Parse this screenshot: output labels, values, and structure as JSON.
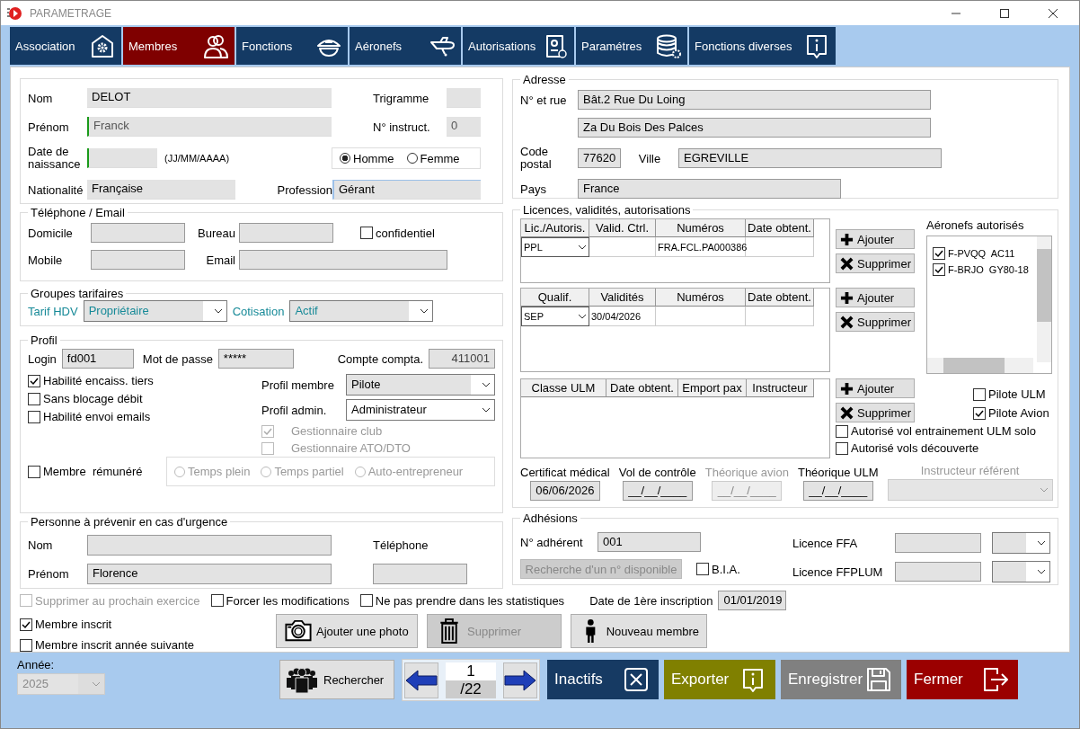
{
  "window": {
    "title": "PARAMETRAGE"
  },
  "tabs": [
    {
      "label": "Association",
      "selected": false
    },
    {
      "label": "Membres",
      "selected": true
    },
    {
      "label": "Fonctions",
      "selected": false
    },
    {
      "label": "Aéronefs",
      "selected": false
    },
    {
      "label": "Autorisations",
      "selected": false
    },
    {
      "label": "Paramétres",
      "selected": false
    },
    {
      "label": "Fonctions diverses",
      "selected": false
    }
  ],
  "identity": {
    "nom": {
      "label": "Nom",
      "value": "DELOT"
    },
    "prenom": {
      "label": "Prénom",
      "value": "Franck"
    },
    "naissance": {
      "label": "Date de naissance",
      "hint": "(JJ/MM/AAAA)"
    },
    "trigramme": {
      "label": "Trigramme"
    },
    "instruct": {
      "label": "N° instruct.",
      "value": "0"
    },
    "genre": [
      {
        "label": "Homme",
        "selected": true
      },
      {
        "label": "Femme",
        "selected": false
      }
    ],
    "nationalite": {
      "label": "Nationalité",
      "value": "Française"
    },
    "profession": {
      "label": "Profession",
      "value": "Gérant"
    }
  },
  "contact": {
    "title": "Téléphone / Email",
    "domicile": {
      "label": "Domicile"
    },
    "bureau": {
      "label": "Bureau"
    },
    "confidentiel": {
      "label": "confidentiel",
      "checked": false
    },
    "mobile": {
      "label": "Mobile"
    },
    "email": {
      "label": "Email"
    }
  },
  "tarifs": {
    "title": "Groupes tarifaires",
    "tarif_hdv": {
      "label": "Tarif HDV",
      "value": "Propriétaire"
    },
    "cotisation": {
      "label": "Cotisation",
      "value": "Actif"
    }
  },
  "profil": {
    "title": "Profil",
    "login": {
      "label": "Login",
      "value": "fd001"
    },
    "mot_de_passe": {
      "label": "Mot de passe",
      "value": "*****"
    },
    "compte": {
      "label": "Compte compta.",
      "value": "411001"
    },
    "options": [
      {
        "label": "Habilité encaiss. tiers",
        "checked": true
      },
      {
        "label": "Sans blocage débit",
        "checked": false
      },
      {
        "label": "Habilité envoi emails",
        "checked": false
      }
    ],
    "profil_membre": {
      "label": "Profil membre",
      "value": "Pilote"
    },
    "profil_admin": {
      "label": "Profil admin.",
      "value": "Administrateur"
    },
    "roles": [
      {
        "label": "Gestionnaire club",
        "checked": true,
        "disabled": true
      },
      {
        "label": "Gestionnaire ATO/DTO",
        "checked": false,
        "disabled": true
      }
    ],
    "remunere": {
      "label": "Membre  rémunéré",
      "checked": false
    },
    "contrat": [
      {
        "label": "Temps plein",
        "selected": false,
        "disabled": true
      },
      {
        "label": "Temps partiel",
        "selected": false,
        "disabled": true
      },
      {
        "label": "Auto-entrepreneur",
        "selected": false,
        "disabled": true
      }
    ]
  },
  "urgence": {
    "title": "Personne à prévenir en cas d'urgence",
    "nom": {
      "label": "Nom"
    },
    "prenom": {
      "label": "Prénom",
      "value": "Florence"
    },
    "telephone": {
      "label": "Téléphone"
    }
  },
  "adresse": {
    "title": "Adresse",
    "rue": {
      "label": "N° et rue",
      "lines": [
        "Bât.2 Rue Du Loing",
        "Za Du Bois Des Palces"
      ]
    },
    "code_postal": {
      "label": "Code postal",
      "value": "77620"
    },
    "ville": {
      "label": "Ville",
      "value": "EGREVILLE"
    },
    "pays": {
      "label": "Pays",
      "value": "France"
    }
  },
  "licences": {
    "title": "Licences, validités, autorisations",
    "tables": [
      {
        "columns": [
          "Lic./Autoris.",
          "Valid. Ctrl.",
          "Numéros",
          "Date obtent."
        ],
        "rows": [
          {
            "choice": "PPL",
            "cells": {
              "2": "FRA.FCL.PA000386"
            }
          }
        ],
        "actions": [
          "Ajouter",
          "Supprimer"
        ]
      },
      {
        "columns": [
          "Qualif.",
          "Validités",
          "Numéros",
          "Date obtent."
        ],
        "rows": [
          {
            "choice": "SEP",
            "cells": {
              "1": "30/04/2026"
            }
          }
        ],
        "actions": [
          "Ajouter",
          "Supprimer"
        ]
      },
      {
        "columns": [
          "Classe ULM",
          "Date obtent.",
          "Emport pax",
          "Instructeur"
        ],
        "actions": [
          "Ajouter",
          "Supprimer"
        ]
      }
    ],
    "aeronefs": {
      "title": "Aéronefs autorisés",
      "items": [
        {
          "label": "F-PVQQ  AC11",
          "checked": true
        },
        {
          "label": "F-BRJO  GY80-18",
          "checked": true
        }
      ]
    },
    "pilote": [
      {
        "label": "Pilote ULM",
        "checked": false
      },
      {
        "label": "Pilote Avion",
        "checked": true
      }
    ],
    "autorisations": [
      {
        "label": "Autorisé vol entrainement ULM solo",
        "checked": false
      },
      {
        "label": "Autorisé vols découverte",
        "checked": false
      }
    ],
    "dates": [
      {
        "label": "Certificat médical",
        "value": "06/06/2026",
        "disabled": false
      },
      {
        "label": "Vol de contrôle",
        "value": "__/__/____",
        "disabled": false
      },
      {
        "label": "Théorique avion",
        "value": "__/__/____",
        "disabled": true
      },
      {
        "label": "Théorique ULM",
        "value": "__/__/____",
        "disabled": false
      }
    ],
    "instructeur_referent": {
      "label": "Instructeur référent",
      "disabled": true
    }
  },
  "adhesions": {
    "title": "Adhésions",
    "numero": {
      "label": "N° adhérent",
      "value": "001"
    },
    "recherche": {
      "label": "Recherche d'un n° disponible",
      "disabled": true
    },
    "bia": {
      "label": "B.I.A.",
      "checked": false
    },
    "licence_ffa": {
      "label": "Licence FFA"
    },
    "licence_ffplum": {
      "label": "Licence FFPLUM"
    }
  },
  "flags": [
    {
      "label": "Supprimer au prochain exercice",
      "checked": false,
      "disabled": true
    },
    {
      "label": "Forcer les modifications",
      "checked": false,
      "disabled": false
    },
    {
      "label": "Ne pas prendre dans les statistiques",
      "checked": false,
      "disabled": false
    }
  ],
  "premiere_inscription": {
    "label": "Date de 1ère inscription",
    "value": "01/01/2019"
  },
  "inscription": [
    {
      "label": "Membre inscrit",
      "checked": true
    },
    {
      "label": "Membre inscrit année suivante",
      "checked": false
    }
  ],
  "actions": [
    {
      "label": "Ajouter une photo",
      "disabled": false
    },
    {
      "label": "Supprimer",
      "disabled": true
    },
    {
      "label": "Nouveau membre",
      "disabled": false
    }
  ],
  "footer": {
    "annee": {
      "label": "Année:",
      "value": "2025",
      "disabled": true
    },
    "rechercher": "Rechercher",
    "page": {
      "current": "1",
      "total": "/22"
    },
    "buttons": [
      {
        "label": "Inactifs",
        "color": "#163a63"
      },
      {
        "label": "Exporter",
        "color": "#808000"
      },
      {
        "label": "Enregistrer",
        "color": "#808080"
      },
      {
        "label": "Fermer",
        "color": "#9b0000"
      }
    ]
  }
}
